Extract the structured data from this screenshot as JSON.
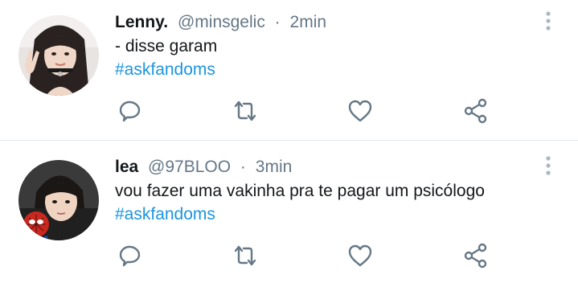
{
  "tweets": [
    {
      "display_name": "Lenny.",
      "handle": "@minsgelic",
      "separator": "·",
      "time": "2min",
      "text": "- disse garam",
      "hashtag": "#askfandoms",
      "avatar_icon": "profile-photo",
      "actions": [
        "reply-icon",
        "retweet-icon",
        "like-icon",
        "share-icon"
      ]
    },
    {
      "display_name": "lea",
      "handle": "@97BLOO",
      "separator": "·",
      "time": "3min",
      "text": "vou fazer uma vakinha pra te pagar um psicólogo",
      "hashtag": "#askfandoms",
      "avatar_icon": "profile-photo",
      "actions": [
        "reply-icon",
        "retweet-icon",
        "like-icon",
        "share-icon"
      ]
    }
  ],
  "colors": {
    "text": "#14171a",
    "secondary": "#657786",
    "link": "#1b95e0",
    "divider": "#e1e8ed",
    "icon": "#657786"
  }
}
